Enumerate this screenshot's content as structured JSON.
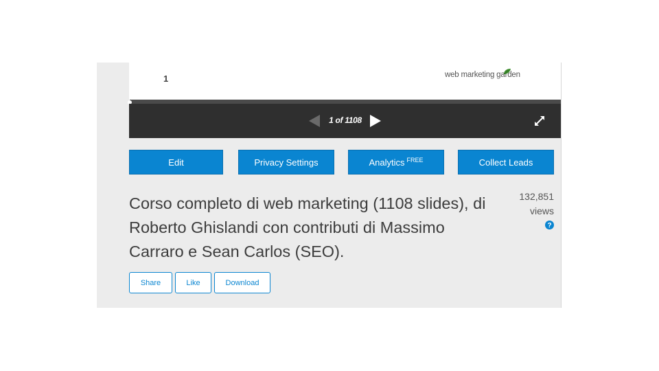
{
  "slide": {
    "page_number": "1",
    "logo_text": "web marketing garden"
  },
  "player": {
    "page_indicator": "1 of 1108",
    "progress_fraction": 0.002,
    "icons": {
      "prev": "triangle-left-icon",
      "next": "triangle-right-icon",
      "fullscreen": "expand-arrows-icon"
    }
  },
  "actions": {
    "edit": "Edit",
    "privacy": "Privacy Settings",
    "analytics": "Analytics",
    "analytics_badge": "FREE",
    "collect_leads": "Collect Leads"
  },
  "presentation": {
    "title": "Corso completo di web marketing (1108 slides), di Roberto Ghislandi con contributi di Massimo Carraro e Sean Carlos (SEO).",
    "view_count": "132,851",
    "views_label": "views"
  },
  "social": {
    "share": "Share",
    "like": "Like",
    "download": "Download"
  },
  "colors": {
    "accent": "#0a85d1",
    "toolbar": "#2f2f2f",
    "panel": "#ececec"
  }
}
